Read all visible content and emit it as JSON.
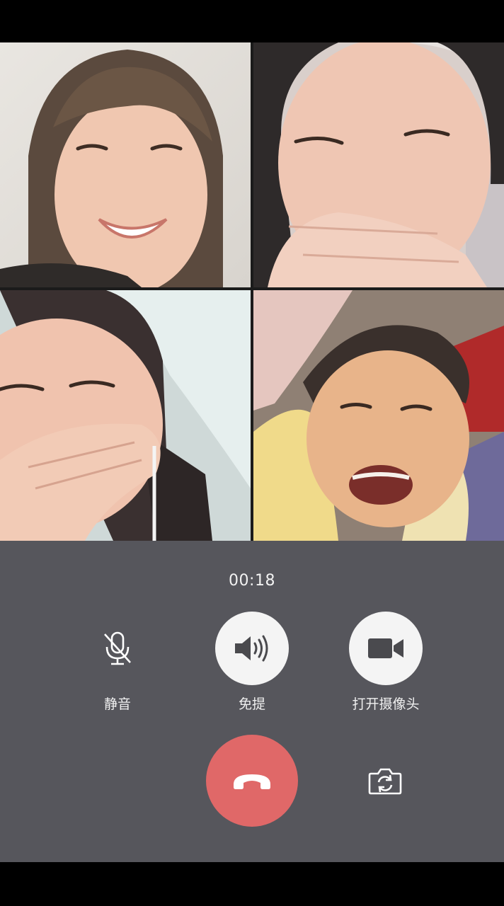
{
  "call": {
    "timer": "00:18",
    "participants": [
      "participant-1",
      "participant-2",
      "participant-3",
      "participant-4"
    ]
  },
  "controls": {
    "mute_label": "静音",
    "speaker_label": "免提",
    "camera_label": "打开摄像头"
  },
  "icons": {
    "mute": "mic-muted-icon",
    "speaker": "speaker-icon",
    "camera": "video-camera-icon",
    "hangup": "phone-hangup-icon",
    "flip": "camera-flip-icon"
  },
  "colors": {
    "panel_bg": "#56565c",
    "hangup": "#e06868",
    "button_bg": "#f4f4f4"
  }
}
